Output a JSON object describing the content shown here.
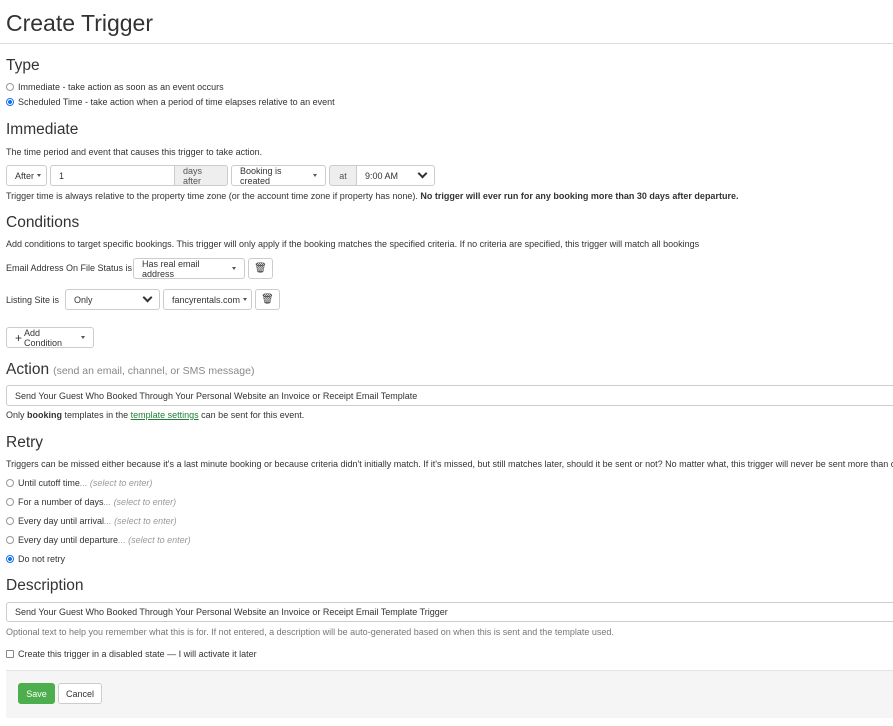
{
  "title": "Create Trigger",
  "type": {
    "heading": "Type",
    "options": [
      {
        "label": "Immediate - take action as soon as an event occurs",
        "selected": false
      },
      {
        "label": "Scheduled Time - take action when a period of time elapses relative to an event",
        "selected": true
      }
    ]
  },
  "immediate": {
    "heading": "Immediate",
    "description": "The time period and event that causes this trigger to take action.",
    "when": "After",
    "amount": "1",
    "unit_label": "days after",
    "event": "Booking is created",
    "at_label": "at",
    "time": "9:00 AM",
    "note": "Trigger time is always relative to the property time zone (or the account time zone if property has none).",
    "note_bold": "No trigger will ever run for any booking more than 30 days after departure."
  },
  "conditions": {
    "heading": "Conditions",
    "description": "Add conditions to target specific bookings. This trigger will only apply if the booking matches the specified criteria. If no criteria are specified, this trigger will match all bookings",
    "rows": [
      {
        "label": "Email Address On File Status is",
        "value": "Has real email address"
      },
      {
        "label": "Listing Site is",
        "operator": "Only",
        "value": "fancyrentals.com"
      }
    ],
    "add_label": "Add Condition"
  },
  "action": {
    "heading": "Action",
    "hint": "(send an email, channel, or SMS message)",
    "value": "Send Your Guest Who Booked Through Your Personal Website an Invoice or Receipt Email Template",
    "note_pre": "Only",
    "note_bold": "booking",
    "note_mid": "templates in the",
    "note_link": "template settings",
    "note_post": "can be sent for this event."
  },
  "retry": {
    "heading": "Retry",
    "description": "Triggers can be missed either because it's a last minute booking or because criteria didn't initially match. If it's missed, but still matches later, should it be sent or not? No matter what, this trigger will never be sent more than once.",
    "select_hint": "(select to enter)",
    "options": [
      {
        "label": "Until cutoff time",
        "selected": false
      },
      {
        "label": "For a number of days",
        "selected": false
      },
      {
        "label": "Every day until arrival",
        "selected": false
      },
      {
        "label": "Every day until departure",
        "selected": false
      },
      {
        "label": "Do not retry",
        "selected": true
      }
    ]
  },
  "description": {
    "heading": "Description",
    "value": "Send Your Guest Who Booked Through Your Personal Website an Invoice or Receipt Email Template Trigger",
    "note": "Optional text to help you remember what this is for. If not entered, a description will be auto-generated based on when this is sent and the template used."
  },
  "disabled_checkbox": {
    "label": "Create this trigger in a disabled state — I will activate it later",
    "checked": false
  },
  "buttons": {
    "save": "Save",
    "cancel": "Cancel"
  },
  "colors": {
    "save": "#4cae4c",
    "link": "#1e7e34",
    "radio": "#1a73e8"
  }
}
